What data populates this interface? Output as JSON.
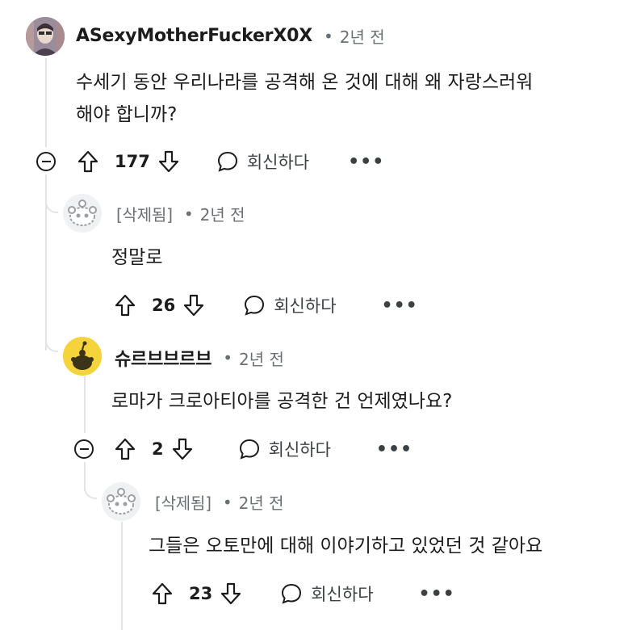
{
  "comments": [
    {
      "author": "ASexyMotherFuckerX0X",
      "time": "2년 전",
      "text_lines": [
        "수세기 동안 우리나라를 공격해 온 것에 대해 왜 자랑스러워",
        "해야 합니까?"
      ],
      "votes": "177",
      "reply_label": "회신하다",
      "more_label": "•••"
    },
    {
      "author": "[삭제됨]",
      "time": "2년 전",
      "text_lines": [
        "정말로"
      ],
      "votes": "26",
      "reply_label": "회신하다",
      "more_label": "•••"
    },
    {
      "author": "슈르브브르브",
      "time": "2년 전",
      "text_lines": [
        "로마가 크로아티아를 공격한 건 언제였나요?"
      ],
      "votes": "2",
      "reply_label": "회신하다",
      "more_label": "•••"
    },
    {
      "author": "[삭제됨]",
      "time": "2년 전",
      "text_lines": [
        "그들은 오토만에 대해 이야기하고 있었던 것 같아요"
      ],
      "votes": "23",
      "reply_label": "회신하다",
      "more_label": "•••"
    }
  ],
  "separator": "•",
  "colors": {
    "text": "#1c1c1c",
    "meta": "#6b7074",
    "thread": "#e2e4e6",
    "avatar_yellow": "#f5d33b"
  }
}
